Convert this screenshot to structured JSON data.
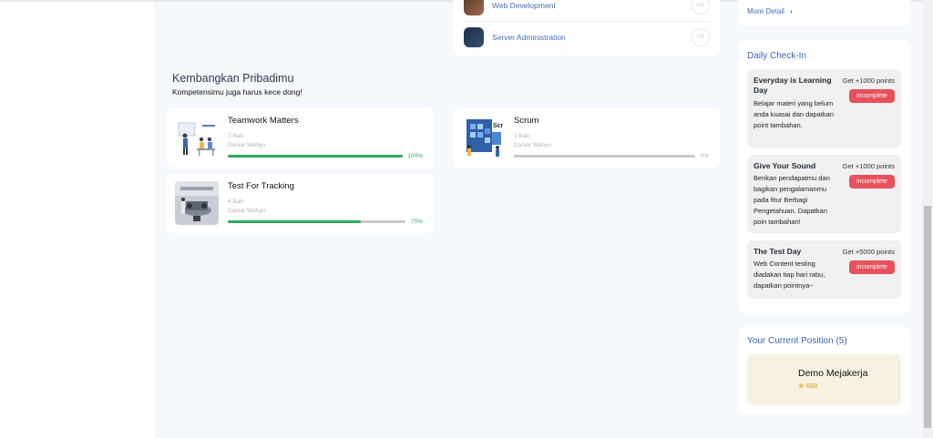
{
  "categories": [
    {
      "label": "Web Development",
      "count": "0%"
    },
    {
      "label": "Server Administration",
      "count": "0%"
    }
  ],
  "section": {
    "title": "Kembangkan Pribadimu",
    "subtitle": "Kompetensimu juga harus kece dong!"
  },
  "courses": [
    {
      "title": "Teamwork Matters",
      "chapters": "7 Bab",
      "author": "Daniar Wahyu",
      "progress": 100,
      "progress_label": "100%"
    },
    {
      "title": "Scrum",
      "chapters": "1 Bab",
      "author": "Daniar Wahyu",
      "progress": 0,
      "progress_label": "0%"
    },
    {
      "title": "Test For Tracking",
      "chapters": "4 Bab",
      "author": "Daniar Wahyu",
      "progress": 75,
      "progress_label": "75%"
    }
  ],
  "more_detail": "More Detail",
  "checkin": {
    "title": "Daily Check-In",
    "items": [
      {
        "title": "Everyday is Learning Day",
        "points": "Get +1000 points",
        "status": "incomplete",
        "desc": "Belajar materi yang belum anda kuasai dan dapatkan point tambahan."
      },
      {
        "title": "Give Your Sound",
        "points": "Get +1000 points",
        "status": "incomplete",
        "desc": "Berikan pendapatmu dan bagikan pengalamanmu pada fitur Berbagi Pengetahuan. Dapatkan poin tambahan!"
      },
      {
        "title": "The Test Day",
        "points": "Get +5000 points",
        "status": "incomplete",
        "desc": "Web Content testing diadakan tiap hari rabu, dapatkan pointnya~"
      }
    ]
  },
  "position": {
    "title": "Your Current Position (5)",
    "name": "Demo Mejakerja",
    "points": "650"
  },
  "colors": {
    "accent": "#3c64b1",
    "success": "#2eaa5c",
    "danger": "#e8505b",
    "star": "#e8b33a"
  }
}
